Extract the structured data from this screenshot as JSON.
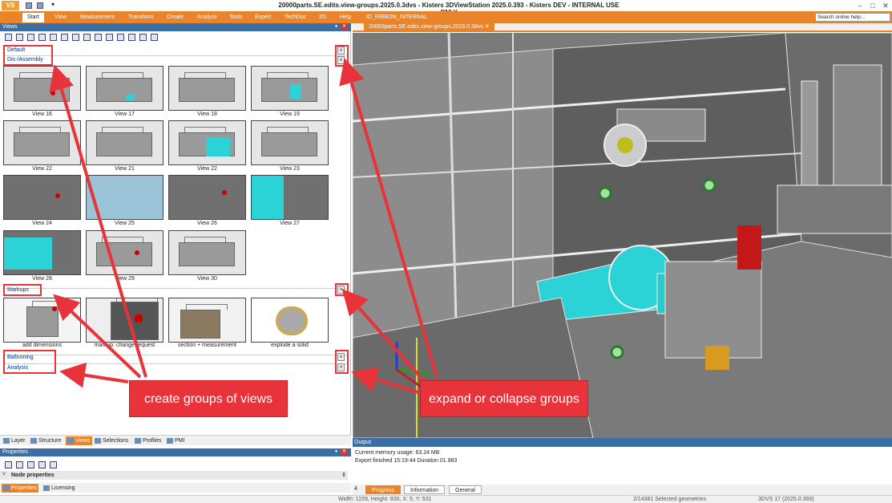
{
  "app": {
    "logo": "VS",
    "title": "20000parts.SE.edits.view-groups.2025.0.3dvs - Kisters 3DViewStation 2025.0.393 - Kisters DEV - INTERNAL USE ONLY",
    "accent": "#e9842a",
    "panel_header_color": "#3a6ea5",
    "callout_color": "#e8333a"
  },
  "ribbon": {
    "tabs": [
      "Start",
      "View",
      "Measurement",
      "Transform",
      "Create",
      "Analyze",
      "Tools",
      "Expert",
      "TechDoc",
      "2D",
      "Help",
      "ID_RIBBON_INTERNAL"
    ],
    "active": "Start",
    "search_placeholder": "Search online help..."
  },
  "views_panel": {
    "title": "Views",
    "groups": {
      "default": "Default",
      "disassembly": "Dis-/Assembly",
      "markups": "Markups",
      "ballooning": "Ballooning",
      "analysis": "Analysis"
    },
    "disassembly_views": [
      "View 16",
      "View 17",
      "View 18",
      "View 19",
      "View 22",
      "View 21",
      "View 22",
      "View 23",
      "View 24",
      "View 25",
      "View 26",
      "View 27",
      "View 28",
      "View 29",
      "View 30"
    ],
    "markup_views": [
      "add dimensions",
      "markup: change request",
      "section + measurement",
      "explode a solid"
    ],
    "bottom_tabs": [
      "Layer",
      "Structure",
      "Views",
      "Selections",
      "Profiles",
      "PMI"
    ],
    "active_tab": "Views"
  },
  "properties": {
    "title": "Properties",
    "node_properties": "Node properties",
    "tabs": [
      "Properties",
      "Licensing"
    ]
  },
  "document_tab": "20000parts.SE.edits.view-groups.2025.0.3dvs",
  "output": {
    "title": "Output",
    "lines": [
      "Current memory usage: 63.24 MB",
      "Export finished 15:19:44 Duration 01.983"
    ],
    "count": "4",
    "tabs": [
      "Progress",
      "Information",
      "General"
    ],
    "active_tab": "Progress"
  },
  "status": {
    "dimensions": "Width: 1159, Height: 830, X: 5, Y: 531",
    "selection": "2/14381 Selected geometries",
    "version": "3DVS 17 (2025.0.393)"
  },
  "annotations": {
    "left": "create groups of views",
    "right": "expand or collapse groups"
  }
}
